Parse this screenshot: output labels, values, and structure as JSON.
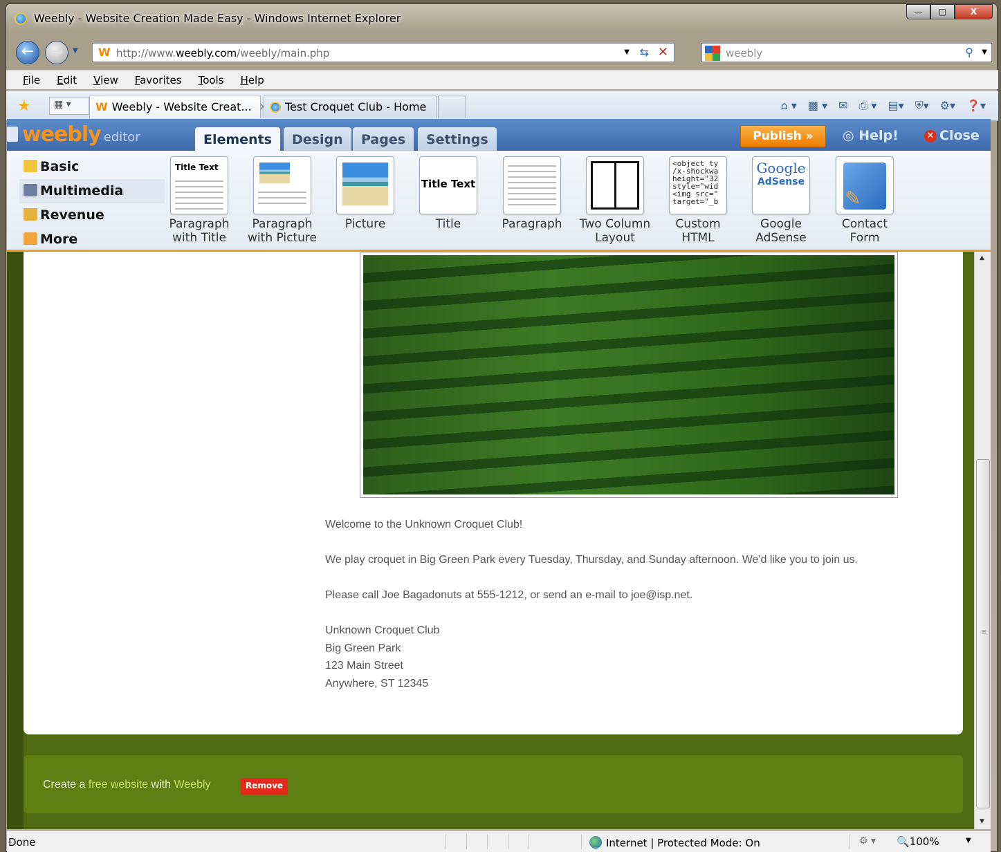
{
  "window": {
    "title": "Weebly - Website Creation Made Easy - Windows Internet Explorer",
    "buttons": {
      "minimize": "—",
      "maximize": "□",
      "close": "X"
    }
  },
  "address": {
    "favicon": "W",
    "url_prefix": "http://www.",
    "url_domain": "weebly.com",
    "url_path": "/weebly/main.php",
    "search_text": "weebly"
  },
  "menu": [
    "File",
    "Edit",
    "View",
    "Favorites",
    "Tools",
    "Help"
  ],
  "tabs": [
    {
      "label": "Weebly - Website Creat...",
      "active": true,
      "favicon": "W"
    },
    {
      "label": "Test Croquet Club - Home",
      "active": false
    }
  ],
  "editor": {
    "logo": "weebly",
    "logo_suffix": "editor",
    "tabs": [
      "Elements",
      "Design",
      "Pages",
      "Settings"
    ],
    "active_tab": "Elements",
    "publish_label": "Publish »",
    "help_label": "Help!",
    "close_label": "Close",
    "categories": [
      {
        "label": "Basic",
        "color": "#f3c33b"
      },
      {
        "label": "Multimedia",
        "color": "#6f7fa0"
      },
      {
        "label": "Revenue",
        "color": "#e6b23c"
      },
      {
        "label": "More",
        "color": "#f1a43b"
      }
    ],
    "elements": [
      {
        "line1": "Paragraph",
        "line2": "with Title",
        "preview_title": "Title Text"
      },
      {
        "line1": "Paragraph",
        "line2": "with Picture"
      },
      {
        "line1": "Picture",
        "line2": ""
      },
      {
        "line1": "Title",
        "line2": "",
        "preview_title": "Title Text"
      },
      {
        "line1": "Paragraph",
        "line2": ""
      },
      {
        "line1": "Two Column",
        "line2": "Layout"
      },
      {
        "line1": "Custom",
        "line2": "HTML",
        "preview_code": "<object ty\n/x-shockwa\nheight=\"32\nstyle=\"wid\n<img src=\"\ntarget=\"_b"
      },
      {
        "line1": "Google",
        "line2": "AdSense",
        "preview_google": "Google",
        "preview_adsense": "AdSense"
      },
      {
        "line1": "Contact",
        "line2": "Form"
      }
    ]
  },
  "page": {
    "paragraphs": [
      "Welcome to the Unknown Croquet Club!",
      "We play croquet in Big Green Park every Tuesday, Thursday, and Sunday afternoon.  We'd like you to join us.",
      "Please call Joe Bagadonuts at 555-1212, or send an e-mail to joe@isp.net."
    ],
    "address_lines": [
      "Unknown Croquet Club",
      "Big Green Park",
      "123 Main Street",
      "Anywhere, ST 12345"
    ],
    "footer": {
      "create": "Create a",
      "free_website": "free website",
      "with": "with",
      "weebly": "Weebly",
      "remove": "Remove"
    }
  },
  "status": {
    "left": "Done",
    "zone": "Internet | Protected Mode: On",
    "zoom": "100%"
  }
}
